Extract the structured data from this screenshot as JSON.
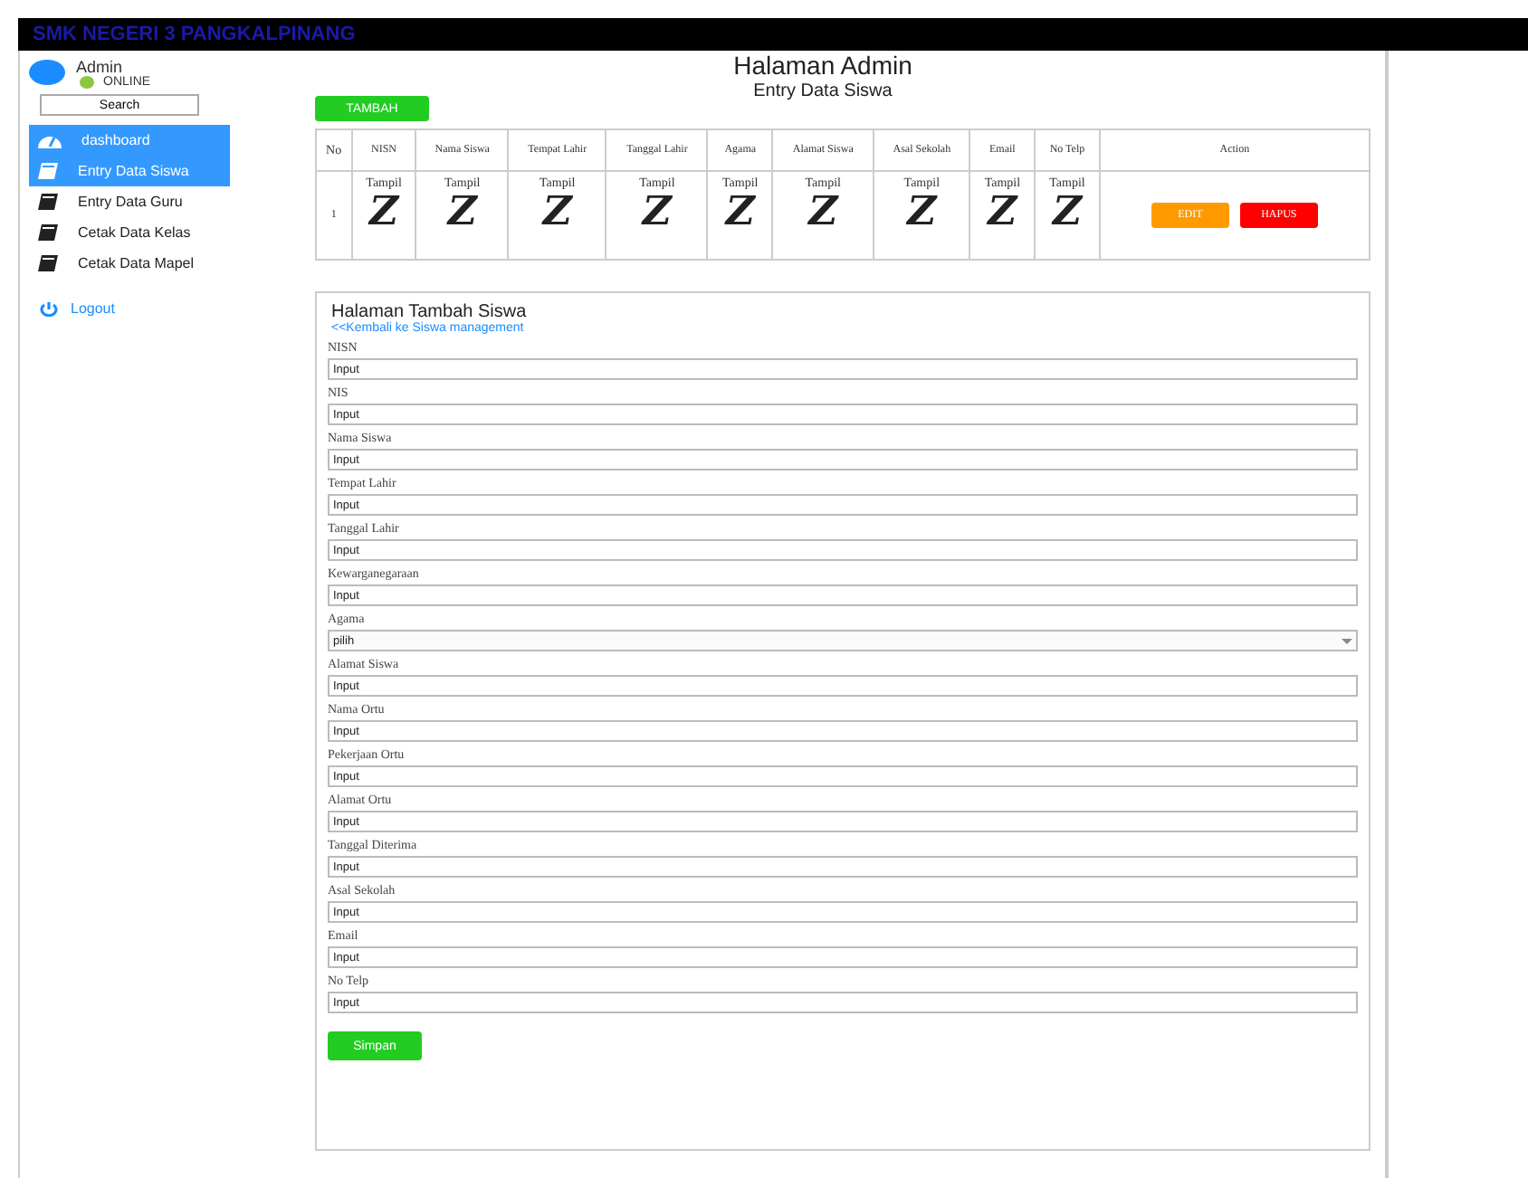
{
  "header": {
    "title": "SMK NEGERI 3 PANGKALPINANG"
  },
  "user": {
    "name": "Admin",
    "status": "ONLINE",
    "online": true
  },
  "search": {
    "label": "Search"
  },
  "sidebar": {
    "items": [
      {
        "label": "dashboard",
        "kind": "gauge",
        "selected": true
      },
      {
        "label": "Entry Data Siswa",
        "kind": "book",
        "selected": true
      },
      {
        "label": "Entry Data Guru",
        "kind": "book",
        "selected": false
      },
      {
        "label": "Cetak Data Kelas",
        "kind": "book",
        "selected": false
      },
      {
        "label": "Cetak Data Mapel",
        "kind": "book",
        "selected": false
      }
    ],
    "logout": "Logout"
  },
  "page": {
    "title": "Halaman Admin",
    "subtitle": "Entry Data Siswa"
  },
  "add_button": "TAMBAH",
  "table": {
    "columns": [
      "No",
      "NISN",
      "Nama Siswa",
      "Tempat Lahir",
      "Tanggal Lahir",
      "Agama",
      "Alamat Siswa",
      "Asal Sekolah",
      "Email",
      "No Telp",
      "Action"
    ],
    "rows": [
      {
        "cells": [
          {
            "kind": "text",
            "text": "1"
          },
          {
            "kind": "image",
            "text": "Tampil",
            "icon": "Z"
          },
          {
            "kind": "image",
            "text": "Tampil",
            "icon": "Z"
          },
          {
            "kind": "image",
            "text": "Tampil",
            "icon": "Z"
          },
          {
            "kind": "image",
            "text": "Tampil",
            "icon": "Z"
          },
          {
            "kind": "image",
            "text": "Tampil",
            "icon": "Z"
          },
          {
            "kind": "image",
            "text": "Tampil",
            "icon": "Z"
          },
          {
            "kind": "image",
            "text": "Tampil",
            "icon": "Z"
          },
          {
            "kind": "image",
            "text": "Tampil",
            "icon": "Z"
          },
          {
            "kind": "image",
            "text": "Tampil",
            "icon": "Z"
          },
          {
            "kind": "actions",
            "actions": [
              {
                "label": "EDIT",
                "kind": "edit"
              },
              {
                "label": "HAPUS",
                "kind": "delete"
              }
            ]
          }
        ]
      }
    ]
  },
  "form": {
    "title": "Halaman Tambah Siswa",
    "back_link": "<<Kembali ke Siswa management",
    "fields": [
      {
        "label": "NISN",
        "kind": "text",
        "value": "Input"
      },
      {
        "label": "NIS",
        "kind": "text",
        "value": "Input"
      },
      {
        "label": "Nama Siswa",
        "kind": "text",
        "value": "Input"
      },
      {
        "label": "Tempat Lahir",
        "kind": "text",
        "value": "Input"
      },
      {
        "label": "Tanggal Lahir",
        "kind": "text",
        "value": "Input"
      },
      {
        "label": "Kewarganegaraan",
        "kind": "text",
        "value": "Input"
      },
      {
        "label": "Agama",
        "kind": "select",
        "value": "pilih"
      },
      {
        "label": "Alamat Siswa",
        "kind": "text",
        "value": "Input"
      },
      {
        "label": "Nama Ortu",
        "kind": "text",
        "value": "Input"
      },
      {
        "label": "Pekerjaan Ortu",
        "kind": "text",
        "value": "Input"
      },
      {
        "label": "Alamat Ortu",
        "kind": "text",
        "value": "Input"
      },
      {
        "label": "Tanggal Diterima",
        "kind": "text",
        "value": "Input"
      },
      {
        "label": "Asal Sekolah",
        "kind": "text",
        "value": "Input"
      },
      {
        "label": "Email",
        "kind": "text",
        "value": "Input"
      },
      {
        "label": "No Telp",
        "kind": "text",
        "value": "Input"
      }
    ],
    "submit": "Simpan"
  }
}
